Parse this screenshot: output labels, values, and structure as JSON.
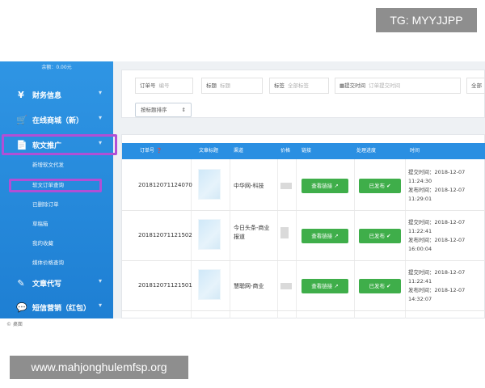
{
  "overlays": {
    "tg": "TG: MYYJJPP",
    "url": "www.mahjonghulemfsp.org"
  },
  "sidebar": {
    "balance": "余额：0.00元",
    "groups": [
      {
        "icon": "yen-icon",
        "glyph": "¥",
        "label": "财务信息"
      },
      {
        "icon": "cart-icon",
        "glyph": "🛒",
        "label": "在线商城（新）"
      },
      {
        "icon": "document-icon",
        "glyph": "📄",
        "label": "软文推广"
      },
      {
        "icon": "edit-icon",
        "glyph": "✎",
        "label": "文章代写"
      },
      {
        "icon": "chat-icon",
        "glyph": "💬",
        "label": "短信营销（红包）"
      }
    ],
    "subitems": [
      "新增软文代发",
      "软文订单查询",
      "已删除订单",
      "草稿箱",
      "我的收藏",
      "媒体价格查询"
    ],
    "footer": "© 桌面"
  },
  "filters": {
    "order_no": {
      "label": "订单号",
      "placeholder": "编号"
    },
    "title": {
      "label": "标题",
      "placeholder": "标题"
    },
    "tag": {
      "label": "标签",
      "placeholder": "全部标签"
    },
    "submit_time": {
      "label": "提交时间",
      "placeholder": "订单提交时间"
    },
    "status": {
      "value": "全部"
    },
    "sort": {
      "label": "按标题排序"
    }
  },
  "table": {
    "headers": [
      "订单号",
      "文章标题",
      "渠道",
      "价格",
      "链接",
      "处理进度",
      "时间"
    ],
    "rows": [
      {
        "order_no": "201812071124070",
        "channel": "中华网-科技",
        "link_button": "查看链接",
        "status": "已发布",
        "submit_time": "提交时间：2018-12-07 11:24:30",
        "publish_time": "发布时间：2018-12-07 11:29:01"
      },
      {
        "order_no": "201812071121502",
        "channel": "今日头条-商业报道",
        "link_button": "查看链接",
        "status": "已发布",
        "submit_time": "提交时间：2018-12-07 11:22:41",
        "publish_time": "发布时间：2018-12-07 16:00:04"
      },
      {
        "order_no": "201812071121501",
        "channel": "慧聪网-商业",
        "link_button": "查看链接",
        "status": "已发布",
        "submit_time": "提交时间：2018-12-07 11:22:41",
        "publish_time": "发布时间：2018-12-07 14:32:07"
      }
    ]
  },
  "colors": {
    "sidebar": "#2f95e4",
    "header": "#2a8fe2",
    "button_green": "#3fae4a",
    "highlight": "#b14fd6"
  }
}
